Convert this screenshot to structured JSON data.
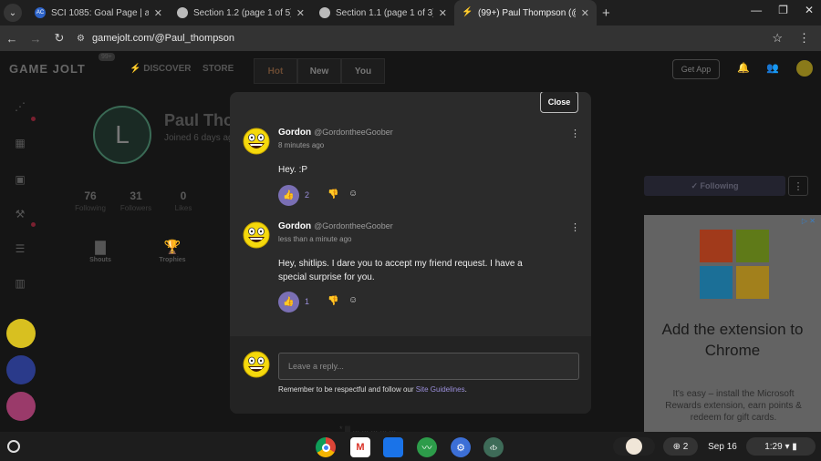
{
  "browser": {
    "tabs": [
      {
        "title": "SCI 1085: Goal Page | aceconn",
        "favicon": "AC",
        "active": false
      },
      {
        "title": "Section 1.2 (page 1 of 5) | acec",
        "favicon": "G",
        "active": false
      },
      {
        "title": "Section 1.1 (page 1 of 3) | acec",
        "favicon": "G",
        "active": false
      },
      {
        "title": "(99+) Paul Thompson (@Paul",
        "favicon": "GJ",
        "active": true
      }
    ],
    "new_tab": "+",
    "url": "gamejolt.com/@Paul_thompson"
  },
  "gamejolt": {
    "logo": "GAME JOLT",
    "badge": "99+",
    "nav": {
      "discover": "DISCOVER",
      "store": "STORE"
    },
    "get_app": "Get App",
    "feed_tabs": [
      "Hot",
      "New",
      "You"
    ]
  },
  "profile": {
    "initial": "L",
    "name": "Paul Tho",
    "joined": "Joined 6 days ag",
    "stats": [
      {
        "num": "76",
        "label": "Following"
      },
      {
        "num": "31",
        "label": "Followers"
      },
      {
        "num": "0",
        "label": "Likes"
      }
    ],
    "shortcuts": [
      {
        "label": "Shouts"
      },
      {
        "label": "Trophies"
      }
    ],
    "following_label": "Following",
    "faint_text": "* lll ... ... ... ... ..."
  },
  "ad": {
    "title": "Add the extension to Chrome",
    "body": "It's easy – install the Microsoft Rewards extension, earn points & redeem for gift cards.",
    "colors": [
      "#f25022",
      "#7fba00",
      "#00a4ef",
      "#ffb900"
    ]
  },
  "modal": {
    "close_label": "Close",
    "comments": [
      {
        "author": "Gordon",
        "handle": "@GordontheeGoober",
        "time": "8 minutes ago",
        "text": "Hey. :P",
        "likes": "2"
      },
      {
        "author": "Gordon",
        "handle": "@GordontheeGoober",
        "time": "less than a minute ago",
        "text": "Hey, shitlips. I dare you to accept my friend request. I have a special surprise for you.",
        "likes": "1"
      }
    ],
    "reply_placeholder": "Leave a reply...",
    "reply_note": "Remember to be respectful and follow our",
    "guidelines_link": "Site Guidelines",
    "reply_note_end": "."
  },
  "shelf": {
    "notification_count": "2",
    "date": "Sep 16",
    "time": "1:29"
  }
}
